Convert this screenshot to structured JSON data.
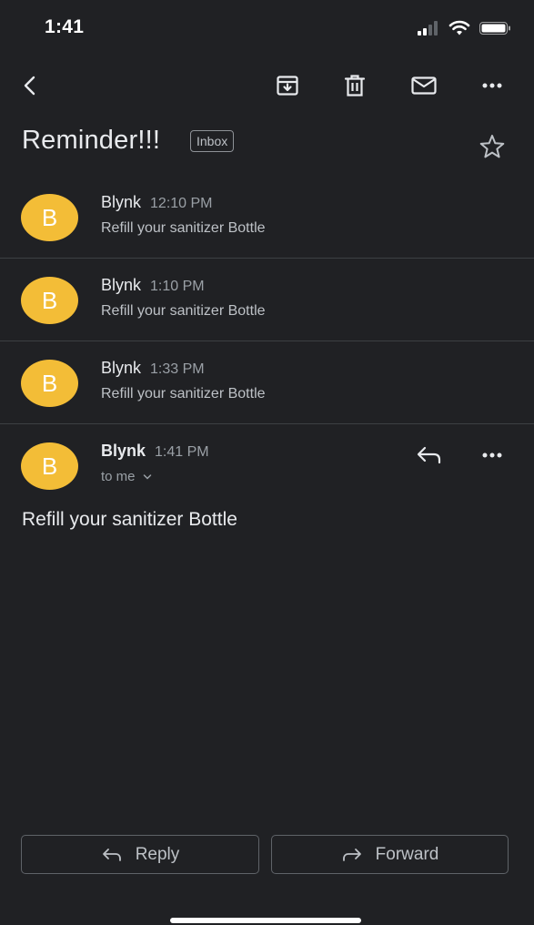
{
  "status_bar": {
    "time": "1:41",
    "icons": [
      "cellular-signal-icon",
      "wifi-icon",
      "battery-icon"
    ]
  },
  "toolbar": {
    "icons": [
      "back-icon",
      "archive-icon",
      "delete-icon",
      "mark-unread-icon",
      "more-icon"
    ]
  },
  "thread": {
    "subject": "Reminder!!!",
    "label": "Inbox",
    "messages": [
      {
        "sender": "Blynk",
        "time": "12:10 PM",
        "snippet": "Refill your sanitizer Bottle",
        "initial": "B"
      },
      {
        "sender": "Blynk",
        "time": "1:10 PM",
        "snippet": "Refill your sanitizer Bottle",
        "initial": "B"
      },
      {
        "sender": "Blynk",
        "time": "1:33 PM",
        "snippet": "Refill your sanitizer Bottle",
        "initial": "B"
      }
    ],
    "open_message": {
      "sender": "Blynk",
      "time": "1:41 PM",
      "recipient": "to me",
      "initial": "B",
      "body": "Refill your sanitizer Bottle"
    }
  },
  "actions": {
    "reply_label": "Reply",
    "forward_label": "Forward"
  },
  "colors": {
    "background": "#202124",
    "avatar": "#f3bd37",
    "divider": "#3c4043",
    "text_primary": "#e8eaed",
    "text_secondary": "#9aa0a6"
  }
}
